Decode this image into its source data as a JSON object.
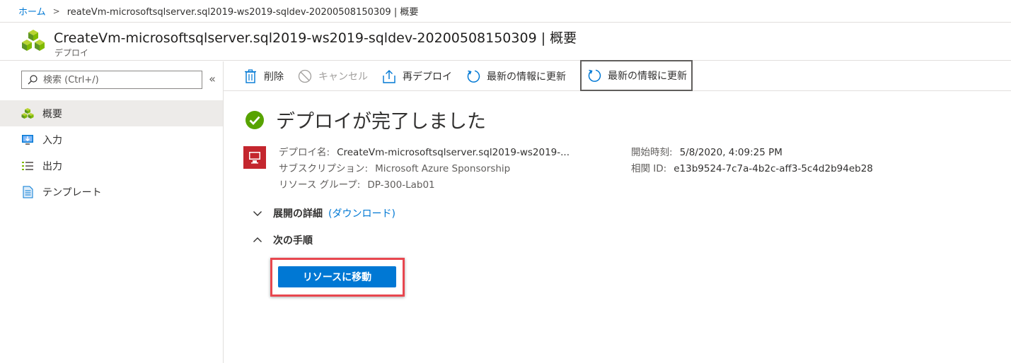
{
  "breadcrumb": {
    "home": "ホーム",
    "separator": ">",
    "current": "reateVm-microsoftsqlserver.sql2019-ws2019-sqldev-20200508150309 | 概要"
  },
  "header": {
    "title": "CreateVm-microsoftsqlserver.sql2019-ws2019-sqldev-20200508150309 | 概要",
    "subtitle": "デプロイ"
  },
  "sidebar": {
    "search_placeholder": "検索 (Ctrl+/)",
    "collapse_label": "«",
    "items": [
      {
        "label": "概要",
        "icon": "overview-icon",
        "active": true
      },
      {
        "label": "入力",
        "icon": "input-icon",
        "active": false
      },
      {
        "label": "出力",
        "icon": "output-icon",
        "active": false
      },
      {
        "label": "テンプレート",
        "icon": "template-icon",
        "active": false
      }
    ]
  },
  "toolbar": {
    "delete": "削除",
    "cancel": "キャンセル",
    "redeploy": "再デプロイ",
    "refresh": "最新の情報に更新",
    "refresh2": "最新の情報に更新"
  },
  "main": {
    "status_heading": "デプロイが完了しました",
    "details": {
      "deployment_name_label": "デプロイ名:",
      "deployment_name_value": "CreateVm-microsoftsqlserver.sql2019-ws2019-...",
      "subscription_label": "サブスクリプション:",
      "subscription_value": "Microsoft Azure Sponsorship",
      "resource_group_label": "リソース グループ:",
      "resource_group_value": "DP-300-Lab01",
      "start_time_label": "開始時刻:",
      "start_time_value": "5/8/2020, 4:09:25 PM",
      "correlation_label": "相関 ID:",
      "correlation_value": "e13b9524-7c7a-4b2c-aff3-5c4d2b94eb28"
    },
    "deployment_details": "展開の詳細",
    "download_link": "(ダウンロード)",
    "next_steps": "次の手順",
    "go_to_resource": "リソースに移動"
  },
  "colors": {
    "accent": "#0078d4",
    "success": "#107c10",
    "highlight": "#e8474f"
  }
}
